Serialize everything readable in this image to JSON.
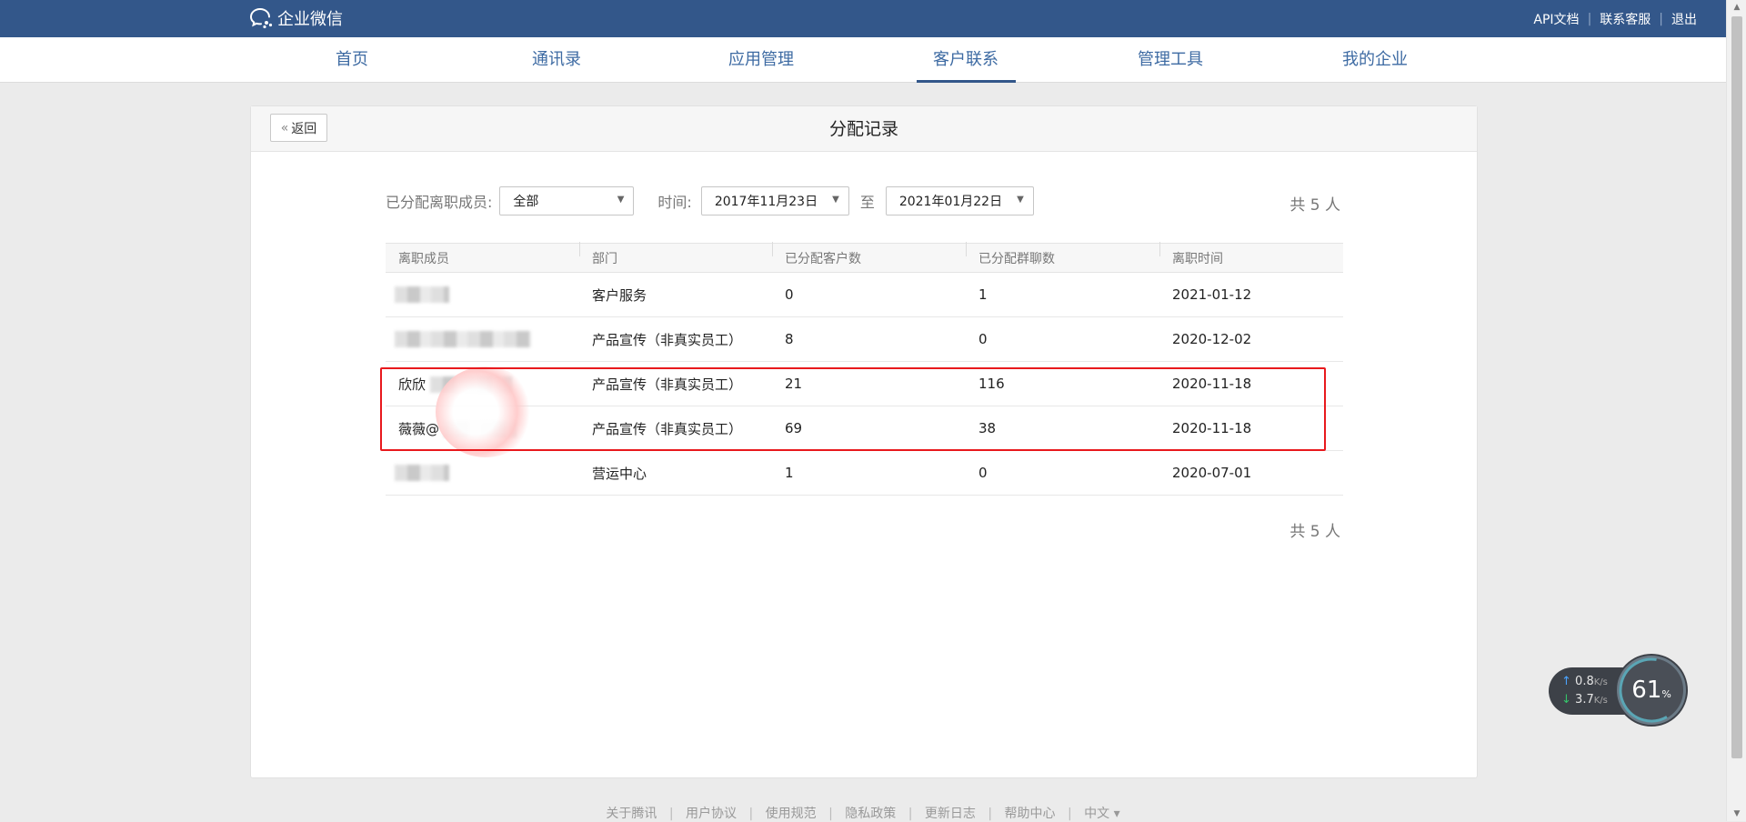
{
  "brand": {
    "name": "企业微信"
  },
  "top_links": [
    {
      "label": "API文档"
    },
    {
      "label": "联系客服"
    },
    {
      "label": "退出"
    }
  ],
  "top_separator": "|",
  "nav": {
    "items": [
      {
        "label": "首页"
      },
      {
        "label": "通讯录"
      },
      {
        "label": "应用管理"
      },
      {
        "label": "客户联系"
      },
      {
        "label": "管理工具"
      },
      {
        "label": "我的企业"
      }
    ],
    "active_index": 3
  },
  "page": {
    "back_label": "返回",
    "title": "分配记录"
  },
  "filters": {
    "member_label": "已分配离职成员:",
    "member_value": "全部",
    "time_label": "时间:",
    "start_date": "2017年11月23日",
    "to_label": "至",
    "end_date": "2021年01月22日"
  },
  "total_label": "共 5 人",
  "table": {
    "columns": [
      "离职成员",
      "部门",
      "已分配客户数",
      "已分配群聊数",
      "离职时间"
    ],
    "rows": [
      {
        "name": "",
        "dept": "客户服务",
        "customers": "0",
        "groups": "1",
        "date": "2021-01-12"
      },
      {
        "name": "",
        "dept": "产品宣传（非真实员工）",
        "customers": "8",
        "groups": "0",
        "date": "2020-12-02"
      },
      {
        "name": "欣欣",
        "dept": "产品宣传（非真实员工）",
        "customers": "21",
        "groups": "116",
        "date": "2020-11-18"
      },
      {
        "name": "薇薇@",
        "dept": "产品宣传（非真实员工）",
        "customers": "69",
        "groups": "38",
        "date": "2020-11-18"
      },
      {
        "name": "",
        "dept": "营运中心",
        "customers": "1",
        "groups": "0",
        "date": "2020-07-01"
      }
    ]
  },
  "footer": {
    "links": [
      "关于腾讯",
      "用户协议",
      "使用规范",
      "隐私政策",
      "更新日志",
      "帮助中心",
      "中文 ▾"
    ]
  },
  "net_monitor": {
    "upload": "0.8",
    "download": "3.7",
    "unit": "K/s",
    "percent": "61",
    "percent_unit": "%"
  },
  "colors": {
    "top_bar": "#33578a",
    "nav_text": "#3e6ba3",
    "highlight": "#e8191d"
  }
}
